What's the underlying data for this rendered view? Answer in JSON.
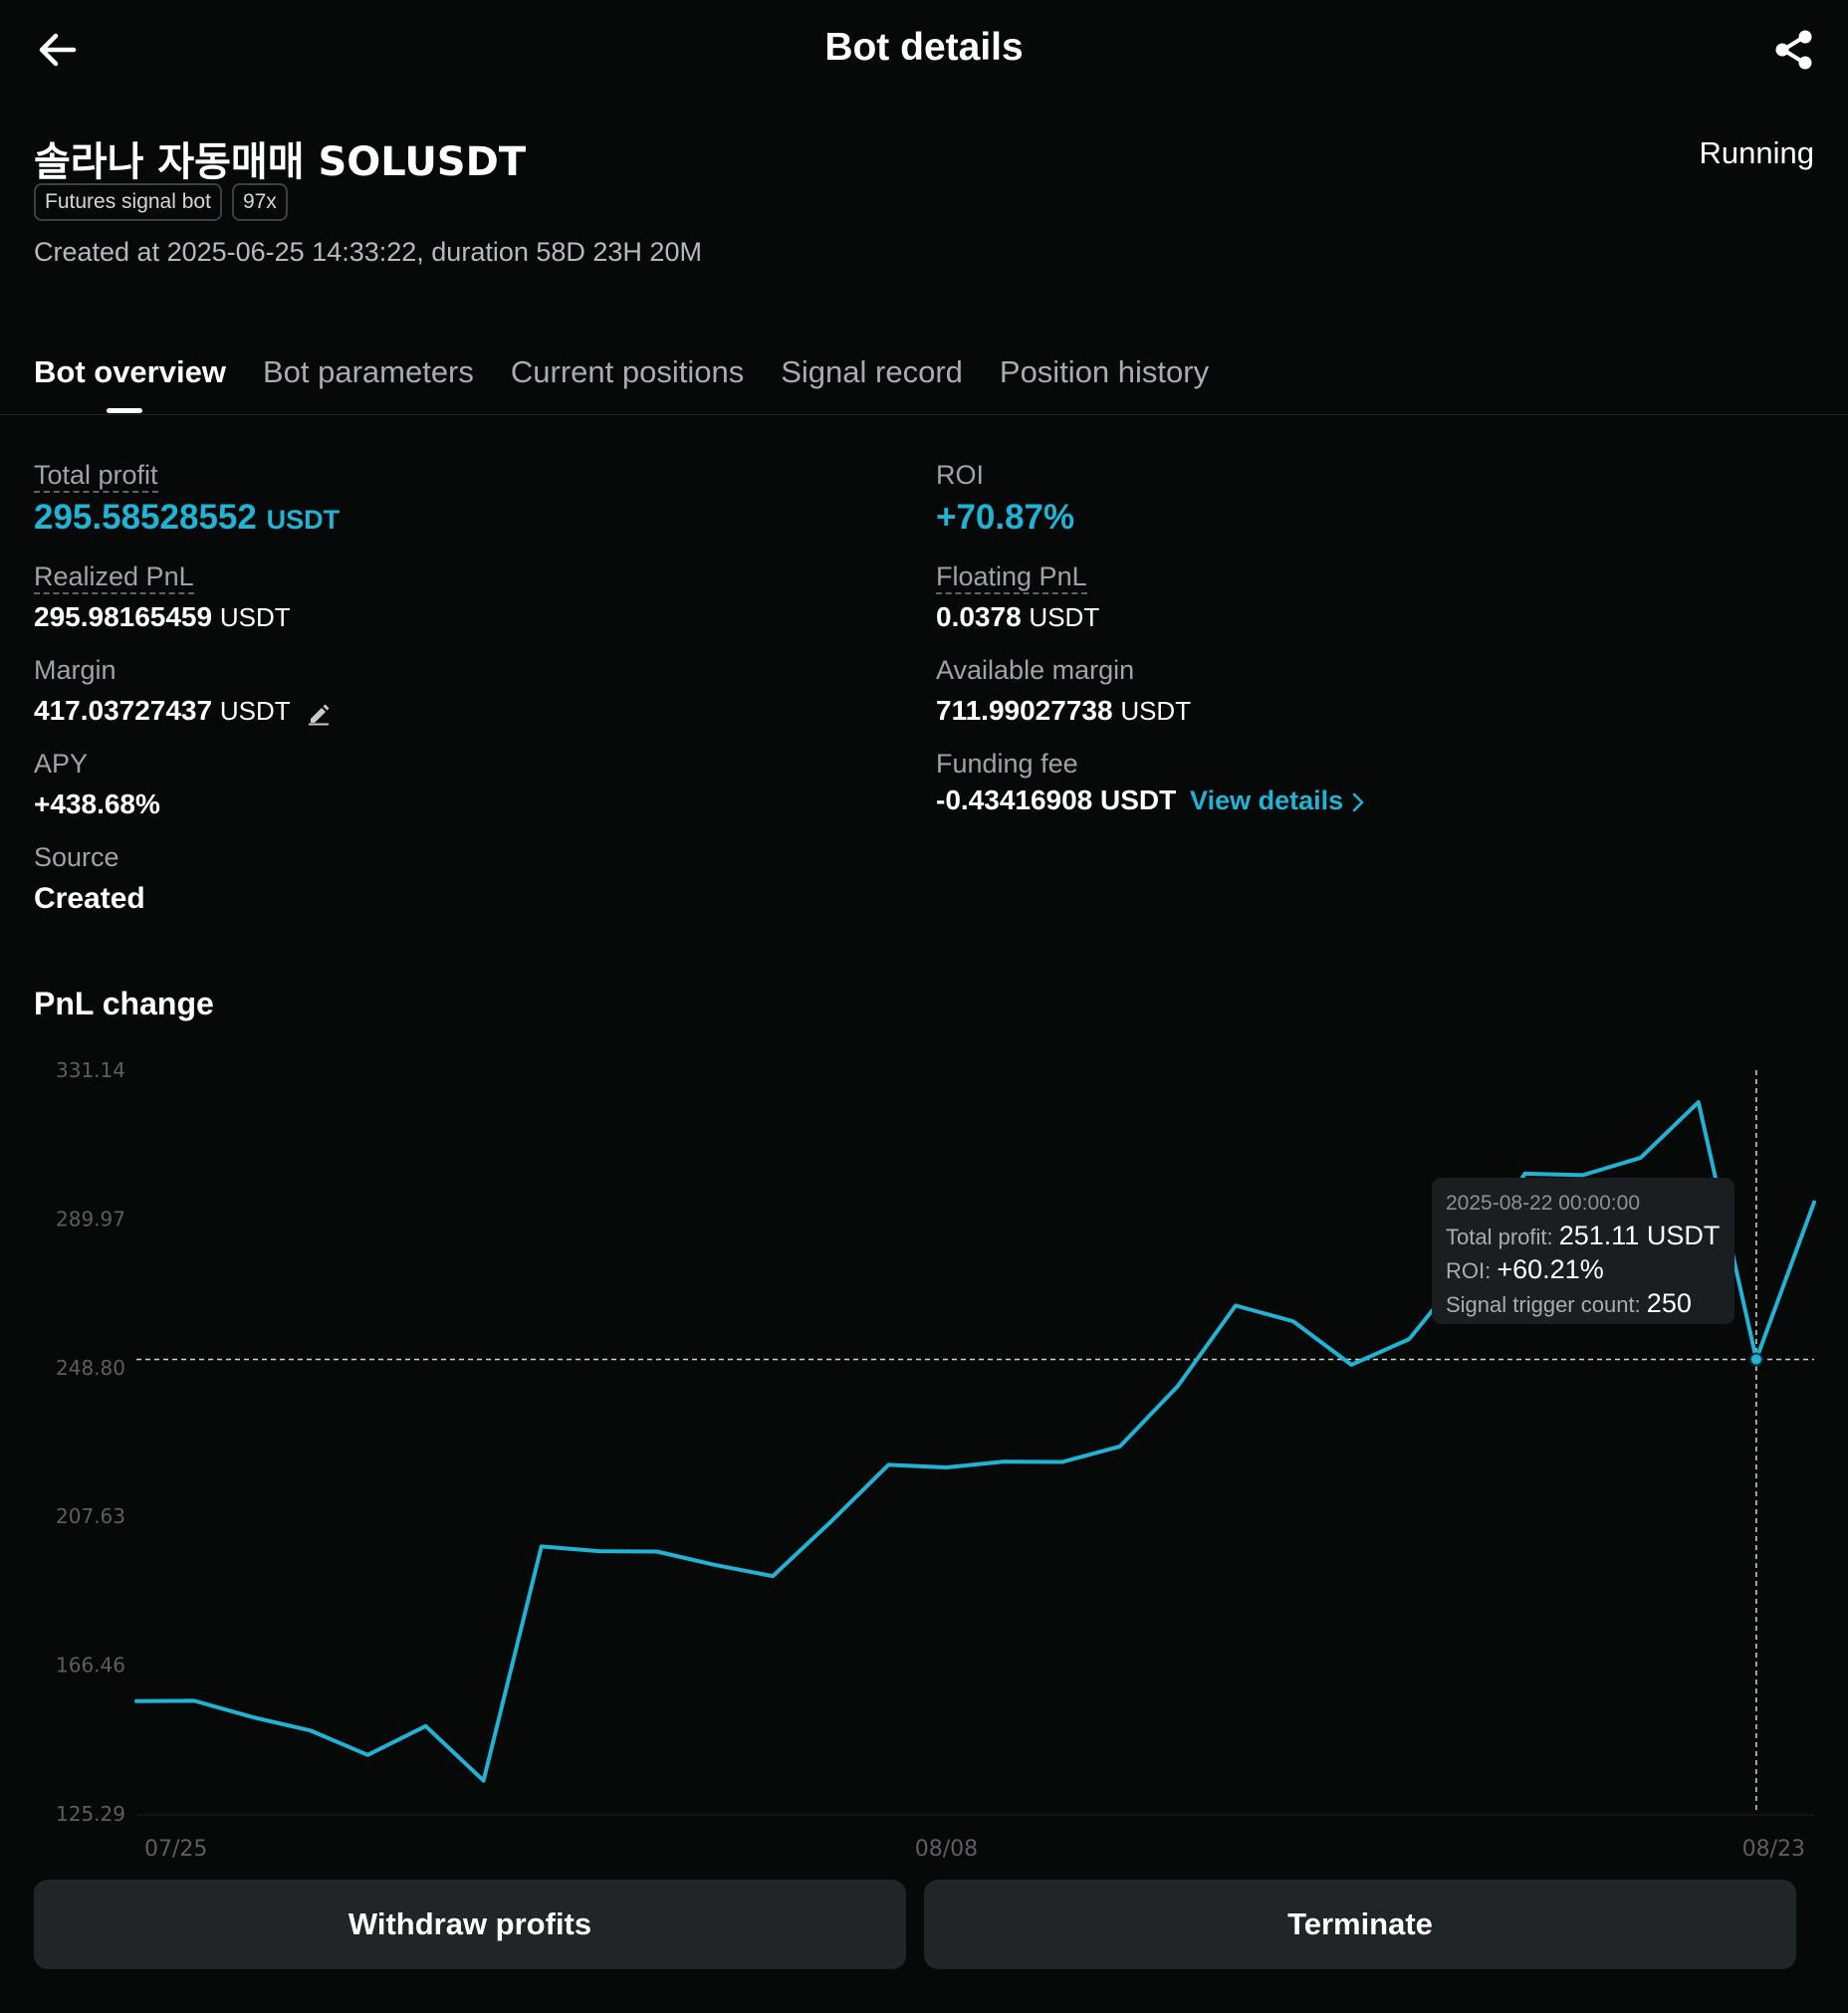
{
  "header": {
    "title": "Bot details",
    "back_icon": "arrow-left-icon",
    "share_icon": "share-icon"
  },
  "bot": {
    "name": "솔라나 자동매매 SOLUSDT",
    "status": "Running",
    "tags": [
      "Futures signal bot",
      "97x"
    ],
    "created_line": "Created at 2025-06-25 14:33:22, duration 58D 23H 20M"
  },
  "tabs": [
    {
      "label": "Bot overview",
      "active": true
    },
    {
      "label": "Bot parameters",
      "active": false
    },
    {
      "label": "Current positions",
      "active": false
    },
    {
      "label": "Signal record",
      "active": false
    },
    {
      "label": "Position history",
      "active": false
    }
  ],
  "stats": {
    "total_profit": {
      "label": "Total profit",
      "value": "295.58528552",
      "unit": "USDT"
    },
    "roi": {
      "label": "ROI",
      "value": "+70.87%"
    },
    "realized_pnl": {
      "label": "Realized PnL",
      "value": "295.98165459",
      "unit": "USDT"
    },
    "floating_pnl": {
      "label": "Floating PnL",
      "value": "0.0378",
      "unit": "USDT"
    },
    "margin": {
      "label": "Margin",
      "value": "417.03727437",
      "unit": "USDT"
    },
    "available_margin": {
      "label": "Available margin",
      "value": "711.99027738",
      "unit": "USDT"
    },
    "apy": {
      "label": "APY",
      "value": "+438.68%"
    },
    "funding_fee": {
      "label": "Funding fee",
      "value": "-0.43416908 USDT",
      "link": "View details"
    },
    "source": {
      "label": "Source",
      "value": "Created"
    }
  },
  "pnl_section": {
    "title": "PnL change"
  },
  "chart_data": {
    "type": "line",
    "y_ticks": [
      "331.14",
      "289.97",
      "248.80",
      "207.63",
      "166.46",
      "125.29"
    ],
    "ylim": [
      125.29,
      331.14
    ],
    "x_tick_labels": [
      {
        "label": "07/25",
        "index": 0
      },
      {
        "label": "08/08",
        "index": 14
      },
      {
        "label": "08/23",
        "index": 29
      }
    ],
    "series": [
      {
        "values": [
          156.5,
          156.6,
          152.1,
          148.4,
          141.6,
          149.6,
          134.5,
          199.3,
          198.0,
          197.9,
          194.2,
          191.1,
          206.1,
          221.9,
          221.2,
          222.8,
          222.7,
          227.0,
          243.7,
          266.0,
          261.6,
          249.6,
          256.7,
          276.5,
          302.5,
          302.1,
          306.9,
          322.3,
          251.1,
          294.6
        ],
        "color": "#22b3d4"
      }
    ],
    "highlight": {
      "index": 28,
      "time": "2025-08-22 00:00:00",
      "total_profit_label": "Total profit:",
      "total_profit": "251.11 USDT",
      "roi_label": "ROI:",
      "roi": "+60.21%",
      "signal_label": "Signal trigger count:",
      "signal_count": "250"
    }
  },
  "footer": {
    "withdraw_label": "Withdraw profits",
    "terminate_label": "Terminate"
  }
}
